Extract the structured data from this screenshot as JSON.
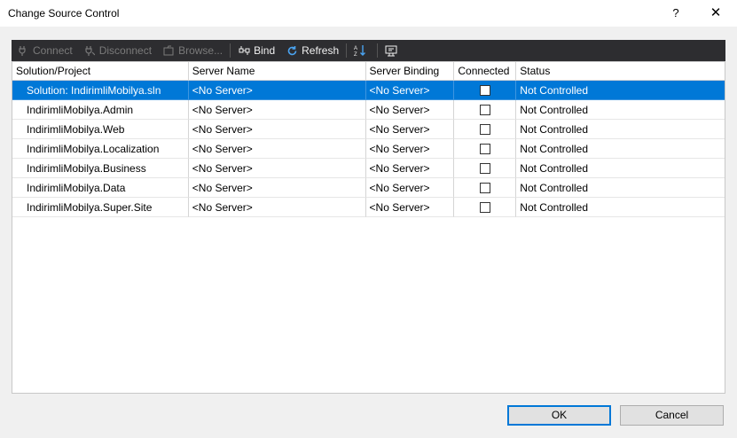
{
  "window": {
    "title": "Change Source Control",
    "help_glyph": "?",
    "close_glyph": "✕"
  },
  "toolbar": {
    "items": [
      {
        "label": "Connect",
        "icon": "plug-icon",
        "enabled": false
      },
      {
        "label": "Disconnect",
        "icon": "unplug-icon",
        "enabled": false
      },
      {
        "label": "Browse...",
        "icon": "browse-icon",
        "enabled": false
      },
      {
        "label": "Bind",
        "icon": "bind-icon",
        "enabled": true
      },
      {
        "label": "Refresh",
        "icon": "refresh-icon",
        "enabled": true
      }
    ],
    "extra_icons": [
      "sort-az-icon",
      "properties-icon"
    ]
  },
  "grid": {
    "columns": [
      "Solution/Project",
      "Server Name",
      "Server Binding",
      "Connected",
      "Status"
    ],
    "rows": [
      {
        "project": "Solution: IndirimliMobilya.sln",
        "server_name": "<No Server>",
        "server_binding": "<No Server>",
        "connected": false,
        "status": "Not Controlled",
        "selected": true
      },
      {
        "project": "IndirimliMobilya.Admin",
        "server_name": "<No Server>",
        "server_binding": "<No Server>",
        "connected": false,
        "status": "Not Controlled",
        "selected": false
      },
      {
        "project": "IndirimliMobilya.Web",
        "server_name": "<No Server>",
        "server_binding": "<No Server>",
        "connected": false,
        "status": "Not Controlled",
        "selected": false
      },
      {
        "project": "IndirimliMobilya.Localization",
        "server_name": "<No Server>",
        "server_binding": "<No Server>",
        "connected": false,
        "status": "Not Controlled",
        "selected": false
      },
      {
        "project": "IndirimliMobilya.Business",
        "server_name": "<No Server>",
        "server_binding": "<No Server>",
        "connected": false,
        "status": "Not Controlled",
        "selected": false
      },
      {
        "project": "IndirimliMobilya.Data",
        "server_name": "<No Server>",
        "server_binding": "<No Server>",
        "connected": false,
        "status": "Not Controlled",
        "selected": false
      },
      {
        "project": "IndirimliMobilya.Super.Site",
        "server_name": "<No Server>",
        "server_binding": "<No Server>",
        "connected": false,
        "status": "Not Controlled",
        "selected": false
      }
    ]
  },
  "buttons": {
    "ok": "OK",
    "cancel": "Cancel"
  },
  "colors": {
    "selection": "#0078d7",
    "toolbar_bg": "#2d2d30",
    "dialog_bg": "#f0f0f0"
  }
}
